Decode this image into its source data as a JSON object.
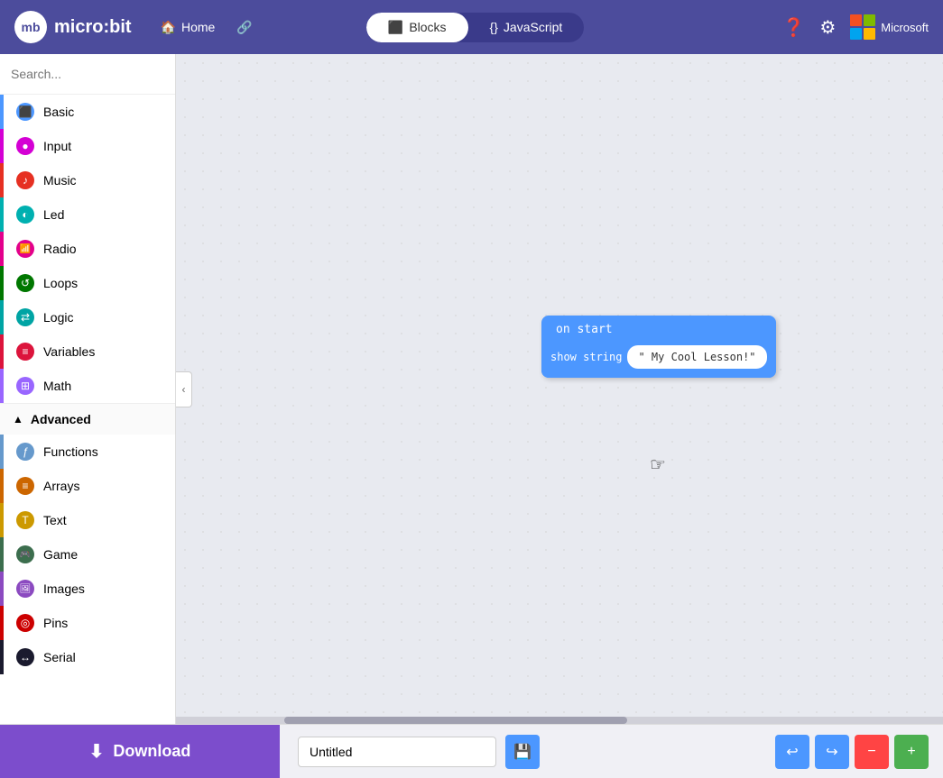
{
  "header": {
    "logo_text": "micro:bit",
    "home_label": "Home",
    "share_icon": "share",
    "blocks_tab": "Blocks",
    "javascript_tab": "JavaScript",
    "help_icon": "?",
    "settings_icon": "⚙",
    "microsoft_label": "Microsoft",
    "active_tab": "blocks"
  },
  "sidebar": {
    "search_placeholder": "Search...",
    "items": [
      {
        "id": "basic",
        "label": "Basic",
        "color": "#4c97ff",
        "icon": "⬛"
      },
      {
        "id": "input",
        "label": "Input",
        "color": "#d400d4",
        "icon": "●"
      },
      {
        "id": "music",
        "label": "Music",
        "color": "#e63022",
        "icon": "🎵"
      },
      {
        "id": "led",
        "label": "Led",
        "color": "#00b0b0",
        "icon": "◐"
      },
      {
        "id": "radio",
        "label": "Radio",
        "color": "#e3008c",
        "icon": "📶"
      },
      {
        "id": "loops",
        "label": "Loops",
        "color": "#007700",
        "icon": "↺"
      },
      {
        "id": "logic",
        "label": "Logic",
        "color": "#00a4a4",
        "icon": "⇄"
      },
      {
        "id": "variables",
        "label": "Variables",
        "color": "#dc143c",
        "icon": "≡"
      },
      {
        "id": "math",
        "label": "Math",
        "color": "#9966ff",
        "icon": "⊞"
      }
    ],
    "advanced_label": "Advanced",
    "advanced_items": [
      {
        "id": "functions",
        "label": "Functions",
        "color": "#6699cc",
        "icon": "ƒ"
      },
      {
        "id": "arrays",
        "label": "Arrays",
        "color": "#cc6600",
        "icon": "≡"
      },
      {
        "id": "text",
        "label": "Text",
        "color": "#cc9900",
        "icon": "T"
      },
      {
        "id": "game",
        "label": "Game",
        "color": "#3c6e4e",
        "icon": "🎮"
      },
      {
        "id": "images",
        "label": "Images",
        "color": "#8b4ac0",
        "icon": "🖼"
      },
      {
        "id": "pins",
        "label": "Pins",
        "color": "#cc0000",
        "icon": "◎"
      },
      {
        "id": "serial",
        "label": "Serial",
        "color": "#1a1a2e",
        "icon": "↔"
      }
    ]
  },
  "block": {
    "header": "on start",
    "command": "show string",
    "value": "\" My Cool Lesson!\""
  },
  "bottom_bar": {
    "download_label": "Download",
    "project_name": "Untitled",
    "save_icon": "💾",
    "undo_icon": "↩",
    "redo_icon": "↪",
    "minus_icon": "−",
    "plus_icon": "+"
  }
}
